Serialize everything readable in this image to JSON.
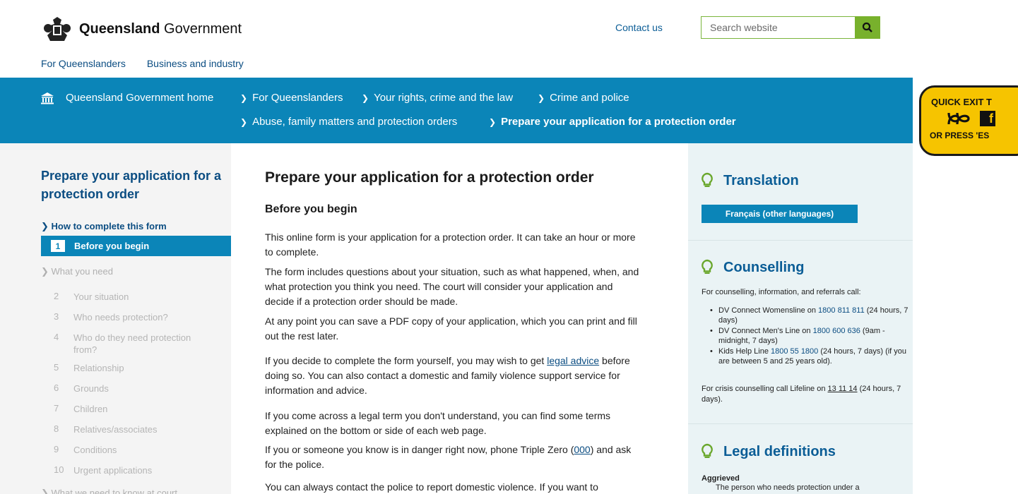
{
  "header": {
    "logo_bold": "Queensland",
    "logo_rest": " Government",
    "contact": "Contact us",
    "search_placeholder": "Search website",
    "topnav": [
      "For Queenslanders",
      "Business and industry"
    ]
  },
  "breadcrumb": [
    "Queensland Government home",
    "For Queenslanders",
    "Your rights, crime and the law",
    "Crime and police",
    "Abuse, family matters and protection orders",
    "Prepare your application for a protection order"
  ],
  "leftnav": {
    "title": "Prepare your application for a protection order",
    "section_active": "How to complete this form",
    "current_num": "1",
    "current_label": "Before you begin",
    "section_need": "What you need",
    "steps": [
      {
        "n": "2",
        "t": "Your situation"
      },
      {
        "n": "3",
        "t": "Who needs protection?"
      },
      {
        "n": "4",
        "t": "Who do they need protection from?"
      },
      {
        "n": "5",
        "t": "Relationship"
      },
      {
        "n": "6",
        "t": "Grounds"
      },
      {
        "n": "7",
        "t": "Children"
      },
      {
        "n": "8",
        "t": "Relatives/associates"
      },
      {
        "n": "9",
        "t": "Conditions"
      },
      {
        "n": "10",
        "t": "Urgent applications"
      }
    ],
    "section_court": "What we need to know at court"
  },
  "main": {
    "title": "Prepare your application for a protection order",
    "subtitle": "Before you begin",
    "p1": "This online form is your application for a protection order. It can take an hour or more to complete.",
    "p2": "The form includes questions about your situation, such as what happened, when, and what protection you think you need. The court will consider your application and decide if a protection order should be made.",
    "p3": "At any point you can save a PDF copy of your application, which you can print and fill out the rest later.",
    "p4_pre": "If you decide to complete the form yourself, you may wish to get ",
    "p4_link": "legal advice",
    "p4_post": " before doing so. You can also contact a domestic and family violence support service for information and advice.",
    "p5": "If you come across a legal term you don't understand, you can find some terms explained on the bottom or side of each web page.",
    "p6_pre": "If you or someone you know is in danger right now, phone Triple Zero (",
    "p6_link": "000",
    "p6_post": ") and ask for the police.",
    "p7": "You can always contact the police to report domestic violence. If you want to"
  },
  "sidebar": {
    "translation_title": "Translation",
    "translation_button": "Français (other languages)",
    "counselling_title": "Counselling",
    "counselling_intro": "For counselling, information, and referrals call:",
    "counselling_items": [
      {
        "pre": "DV Connect Womensline on ",
        "num": "1800 811 811",
        "post": " (24 hours, 7 days)"
      },
      {
        "pre": "DV Connect Men's Line on ",
        "num": "1800 600 636",
        "post": " (9am - midnight, 7 days)"
      },
      {
        "pre": "Kids Help Line ",
        "num": "1800 55 1800",
        "post": " (24 hours, 7 days) (if you are between 5 and 25 years old)."
      }
    ],
    "crisis_pre": "For crisis counselling call Lifeline on ",
    "crisis_link": "13 11 14",
    "crisis_post": " (24 hours, 7 days).",
    "legal_title": "Legal definitions",
    "def_term": "Aggrieved",
    "def_body": "The person who needs protection under a"
  },
  "quickexit": {
    "top": "QUICK EXIT T",
    "logo": "ABC",
    "fb": "f",
    "bottom": "OR PRESS 'ES"
  },
  "colors": {
    "brand_blue": "#0b85b8",
    "link_blue": "#0b4d82",
    "search_green": "#78b12c",
    "quickexit_yellow": "#f6c400"
  }
}
